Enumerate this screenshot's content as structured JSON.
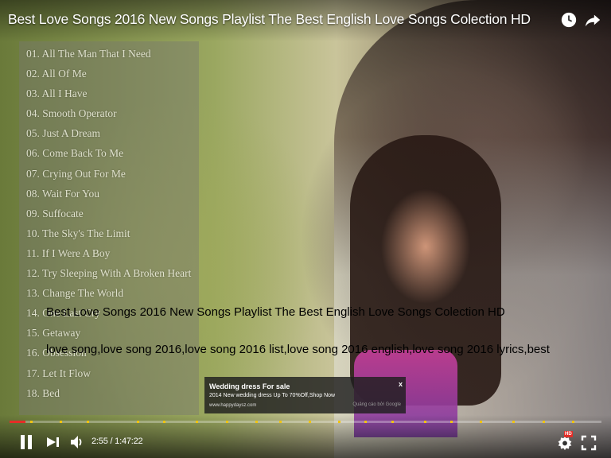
{
  "video": {
    "title": "Best Love Songs 2016 New Songs Playlist The Best English Love Songs Colection HD"
  },
  "playlist": [
    "01. All The Man That I Need",
    "02. All Of Me",
    "03. All I Have",
    "04. Smooth Operator",
    "05. Just A Dream",
    "06. Come Back To Me",
    "07. Crying Out For Me",
    "08. Wait For You",
    "09. Suffocate",
    "10. The Sky's The Limit",
    "11. If I Were A Boy",
    "12. Try Sleeping With A Broken Heart",
    "13. Change The World",
    "14. One Last Cry",
    "15. Getaway",
    "16. Obsession",
    "17. Let It Flow",
    "18. Bed"
  ],
  "captions": {
    "line1": "Best Love Songs 2016 New Songs Playlist The Best English Love Songs Colection HD",
    "line2": "love song,love song 2016,love song 2016 list,love song 2016 english,love song 2016 lyrics,best"
  },
  "ad": {
    "title": "Wedding dress For sale",
    "text": "2014 New wedding dress Up To 70%Off,Shop Now",
    "url": "www.happydaysz.com",
    "close": "x",
    "attribution": "Quảng cáo bởi Google"
  },
  "controls": {
    "time": "2:55 / 1:47:22",
    "progress": 0.027,
    "hd_badge": "HD",
    "marker_fractions": [
      0.035,
      0.085,
      0.13,
      0.215,
      0.26,
      0.315,
      0.365,
      0.415,
      0.455,
      0.505,
      0.555,
      0.6,
      0.645,
      0.7,
      0.745,
      0.795,
      0.85,
      0.9,
      0.95
    ],
    "accent_color": "#e52d27",
    "marker_color": "#f1c40f"
  },
  "icons": {
    "watch_later": "clock-icon",
    "share": "share-arrow-icon",
    "play_pause": "pause-icon",
    "next": "next-icon",
    "volume": "volume-icon",
    "settings": "gear-icon",
    "fullscreen": "fullscreen-icon"
  }
}
